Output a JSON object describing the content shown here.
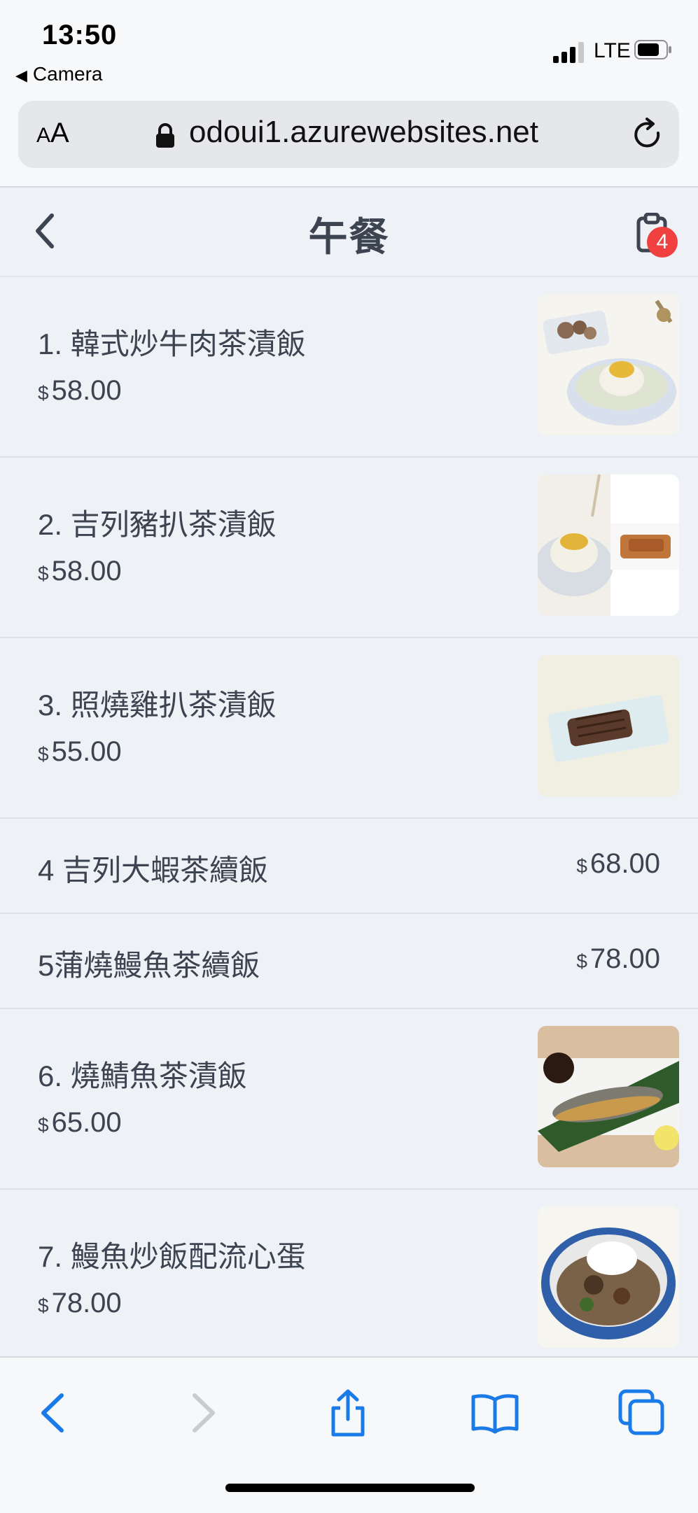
{
  "status_bar": {
    "time": "13:50",
    "back_app": "Camera",
    "network": "LTE"
  },
  "browser": {
    "text_size_small": "A",
    "text_size_large": "A",
    "url": "odoui1.azurewebsites.net"
  },
  "header": {
    "title": "午餐",
    "cart_count": "4"
  },
  "currency": "$",
  "menu": {
    "items": [
      {
        "name": "1. 韓式炒牛肉茶漬飯",
        "price": "58.00"
      },
      {
        "name": "2. 吉列豬扒茶漬飯",
        "price": "58.00"
      },
      {
        "name": "3. 照燒雞扒茶漬飯",
        "price": "55.00"
      },
      {
        "name": "4 吉列大蝦茶續飯",
        "price": "68.00"
      },
      {
        "name": "5蒲燒鰻魚茶續飯",
        "price": "78.00"
      },
      {
        "name": "6. 燒鯖魚茶漬飯",
        "price": "65.00"
      },
      {
        "name": "7. 鰻魚炒飯配流心蛋",
        "price": "78.00"
      }
    ]
  },
  "colors": {
    "accent": "#1a7ae8",
    "badge": "#f04040",
    "background": "#eef1f5"
  },
  "icons": [
    "back-chevron-icon",
    "cart-clipboard-icon",
    "lock-icon",
    "reload-icon",
    "share-icon",
    "bookmarks-icon",
    "tabs-icon"
  ]
}
